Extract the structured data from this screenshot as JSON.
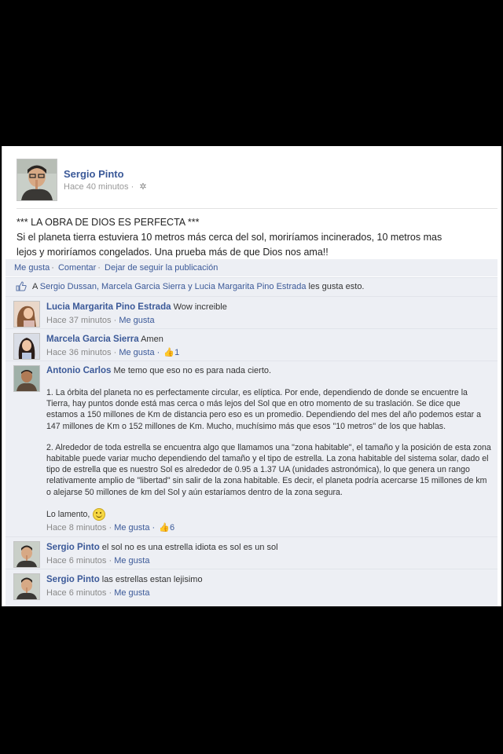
{
  "post": {
    "author": "Sergio Pinto",
    "time": "Hace 40 minutos ·",
    "title_line": "*** LA OBRA DE DIOS ES PERFECTA ***",
    "body_lines": [
      "Si el planeta tierra estuviera 10 metros más cerca del sol, moriríamos incinerados, 10 metros mas",
      "lejos y moriríamos congelados. Una prueba más de que Dios nos ama!!"
    ]
  },
  "actions": {
    "like": "Me gusta",
    "comment": "Comentar",
    "unfollow": "Dejar de seguir la publicación"
  },
  "likes": {
    "prefix": "A ",
    "names": "Sergio Dussan, Marcela Garcia Sierra y Lucia Margarita Pino Estrada",
    "suffix": " les gusta esto."
  },
  "comments": [
    {
      "name": "Lucia Margarita Pino Estrada",
      "text": "Wow increible",
      "time": "Hace 37 minutos ·",
      "like": "Me gusta"
    },
    {
      "name": "Marcela Garcia Sierra",
      "text": "Amen",
      "time": "Hace 36 minutos ·",
      "like": "Me gusta ·",
      "likes": "1"
    },
    {
      "name": "Antonio Carlos",
      "text": "Me temo que eso no es para nada cierto.",
      "paragraphs": [
        "1. La órbita del planeta no es perfectamente circular, es elíptica. Por ende, dependiendo de donde se encuentre la Tierra, hay puntos donde está mas cerca o más lejos del Sol que en otro momento de su traslación. Se dice que estamos a 150 millones de Km de distancia pero eso es un promedio. Dependiendo del mes del año podemos estar a 147 millones de Km o 152 millones de Km. Mucho, muchísimo más que esos \"10 metros\" de los que hablas.",
        "2. Alrededor de toda estrella se encuentra algo que llamamos una \"zona habitable\", el tamaño y la posición de esta zona habitable puede variar mucho dependiendo del tamaño y el tipo de estrella. La zona habitable del sistema solar, dado el tipo de estrella que es nuestro Sol es alrededor de 0.95 a 1.37 UA (unidades astronómica), lo que genera un rango relativamente amplio de \"libertad\" sin salir de la zona habitable. Es decir, el planeta podría acercarse 15 millones de km o alejarse 50 millones de km del Sol y aún estaríamos dentro de la zona segura.",
        "Lo lamento,"
      ],
      "time": "Hace 8 minutos ·",
      "like": "Me gusta ·",
      "likes": "6"
    },
    {
      "name": "Sergio Pinto",
      "text": "el sol no es una estrella idiota es sol es un sol",
      "time": "Hace 6 minutos ·",
      "like": "Me gusta"
    },
    {
      "name": "Sergio Pinto",
      "text": "las estrellas estan lejisimo",
      "time": "Hace 6 minutos ·",
      "like": "Me gusta"
    }
  ]
}
